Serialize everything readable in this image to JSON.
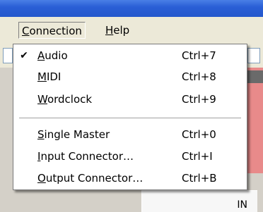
{
  "menubar": {
    "items": [
      {
        "label_prefix": "",
        "mnemonic": "C",
        "label_rest": "onnection"
      },
      {
        "label_prefix": "",
        "mnemonic": "H",
        "label_rest": "elp"
      }
    ]
  },
  "status": {
    "in_label": "IN"
  },
  "dropdown": {
    "items": [
      {
        "checked": true,
        "check_glyph": "✔",
        "mnemonic": "A",
        "rest": "udio",
        "shortcut": "Ctrl+7"
      },
      {
        "checked": false,
        "check_glyph": "",
        "mnemonic": "M",
        "rest": "IDI",
        "shortcut": "Ctrl+8"
      },
      {
        "checked": false,
        "check_glyph": "",
        "mnemonic": "W",
        "rest": "ordclock",
        "shortcut": "Ctrl+9"
      },
      {
        "checked": false,
        "check_glyph": "",
        "mnemonic": "S",
        "rest": "ingle Master",
        "shortcut": "Ctrl+0"
      },
      {
        "checked": false,
        "check_glyph": "",
        "mnemonic": "I",
        "rest": "nput Connector…",
        "shortcut": "Ctrl+I"
      },
      {
        "checked": false,
        "check_glyph": "",
        "mnemonic": "O",
        "rest": "utput Connector…",
        "shortcut": "Ctrl+B"
      }
    ]
  },
  "colors": {
    "titlebar": "#2a5fd6",
    "menubar": "#ece9d8",
    "menu_bg": "#ffffff",
    "accent_panel": "#e88a8a"
  }
}
